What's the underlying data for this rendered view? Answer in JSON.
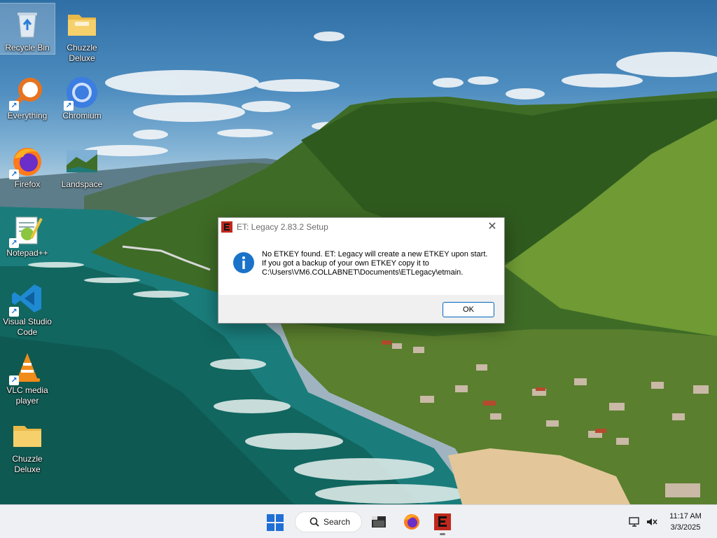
{
  "desktop": {
    "icons": [
      {
        "label": "Recycle Bin",
        "icon": "recycle-bin-icon"
      },
      {
        "label": "Chuzzle Deluxe",
        "icon": "folder-icon"
      },
      {
        "label": "Everything",
        "icon": "everything-search-icon"
      },
      {
        "label": "Chromium",
        "icon": "chromium-icon"
      },
      {
        "label": "Firefox",
        "icon": "firefox-icon"
      },
      {
        "label": "Landspace",
        "icon": "landscape-image-icon"
      },
      {
        "label": "Notepad++",
        "icon": "notepad-plus-plus-icon"
      },
      {
        "label": "Visual Studio Code",
        "icon": "vscode-icon"
      },
      {
        "label": "VLC media player",
        "icon": "vlc-icon"
      },
      {
        "label": "Chuzzle Deluxe",
        "icon": "folder-icon"
      }
    ]
  },
  "dialog": {
    "title": "ET: Legacy 2.83.2 Setup",
    "message_lines": [
      "No ETKEY found. ET: Legacy will create a new ETKEY upon start.",
      "If you got a backup of your own ETKEY copy it to",
      "C:\\Users\\VM6.COLLABNET\\Documents\\ETLegacy\\etmain."
    ],
    "ok_label": "OK",
    "close_glyph": "✕"
  },
  "taskbar": {
    "search_label": "Search",
    "apps": [
      "file-explorer-icon",
      "firefox-icon",
      "etlegacy-icon"
    ],
    "clock": {
      "time": "11:17 AM",
      "date": "3/3/2025"
    }
  },
  "colors": {
    "accent": "#0067c0",
    "info_blue": "#1a73c9",
    "et_red": "#c0281e"
  }
}
